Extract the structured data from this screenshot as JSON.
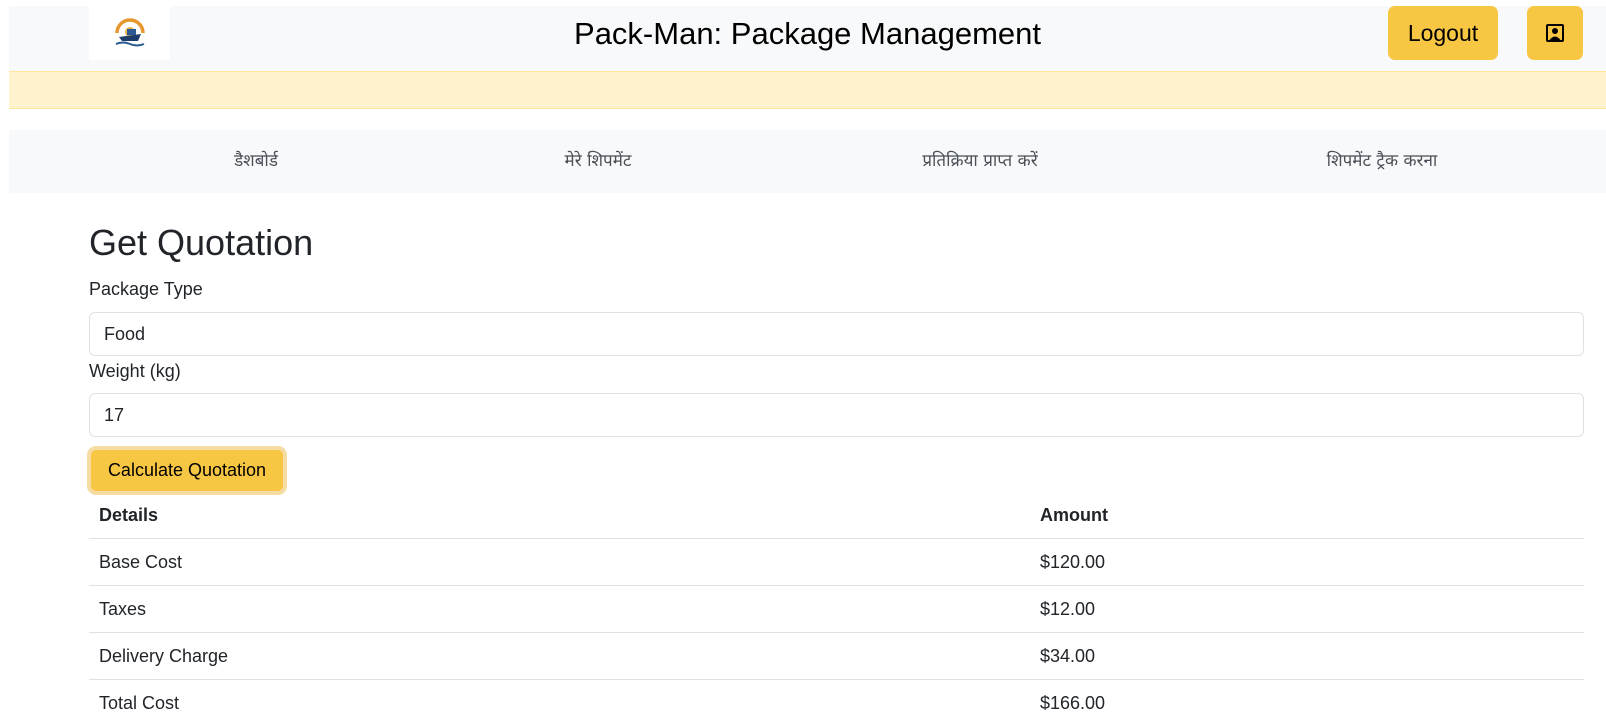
{
  "header": {
    "title": "Pack-Man: Package Management",
    "logout_label": "Logout",
    "logo_icon": "ship-logo-icon",
    "profile_icon": "user-card-icon"
  },
  "nav": {
    "items": [
      {
        "label": "डैशबोर्ड"
      },
      {
        "label": "मेरे शिपमेंट"
      },
      {
        "label": "प्रतिक्रिया प्राप्त करें"
      },
      {
        "label": "शिपमेंट ट्रैक करना"
      }
    ]
  },
  "form": {
    "heading": "Get Quotation",
    "package_type_label": "Package Type",
    "package_type_value": "Food",
    "weight_label": "Weight (kg)",
    "weight_value": "17",
    "submit_label": "Calculate Quotation"
  },
  "quote_table": {
    "headers": [
      "Details",
      "Amount"
    ],
    "rows": [
      {
        "detail": "Base Cost",
        "amount": "$120.00"
      },
      {
        "detail": "Taxes",
        "amount": "$12.00"
      },
      {
        "detail": "Delivery Charge",
        "amount": "$34.00"
      },
      {
        "detail": "Total Cost",
        "amount": "$166.00"
      }
    ]
  },
  "colors": {
    "accent": "#f7c744",
    "alert_bg": "#fff3cd",
    "nav_bg": "#f8f9fa"
  }
}
